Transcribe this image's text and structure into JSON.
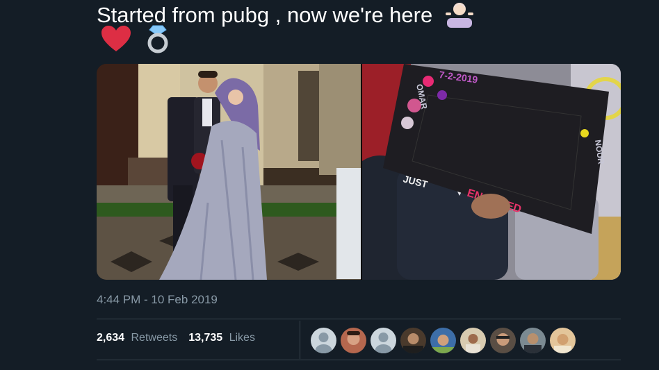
{
  "tweet": {
    "text": "Started from pubg , now we're here",
    "emojis": [
      "woman-shrugging-icon",
      "red-heart-icon",
      "ring-icon"
    ]
  },
  "media": {
    "right_photo_sign": {
      "date": "7-2-2019",
      "left_name": "OMAR",
      "right_name": "NOUR",
      "caption_1": "JUST",
      "caption_2": "ENGAGED"
    }
  },
  "meta": {
    "timestamp": "4:44 PM - 10 Feb 2019"
  },
  "stats": {
    "retweets_count": "2,634",
    "retweets_label": "Retweets",
    "likes_count": "13,735",
    "likes_label": "Likes"
  },
  "avatars": [
    {
      "type": "default"
    },
    {
      "type": "photo",
      "color": "#b5674e"
    },
    {
      "type": "default"
    },
    {
      "type": "photo",
      "color": "#4a3a2c"
    },
    {
      "type": "photo",
      "color": "#3d6ea8"
    },
    {
      "type": "photo",
      "color": "#d8cbb0"
    },
    {
      "type": "photo",
      "color": "#5a4e44"
    },
    {
      "type": "photo",
      "color": "#7b8a92"
    },
    {
      "type": "photo",
      "color": "#e3c59a"
    }
  ],
  "colors": {
    "background": "#141d26",
    "muted": "#8899a6",
    "divider": "#38444d",
    "text": "#ffffff"
  }
}
